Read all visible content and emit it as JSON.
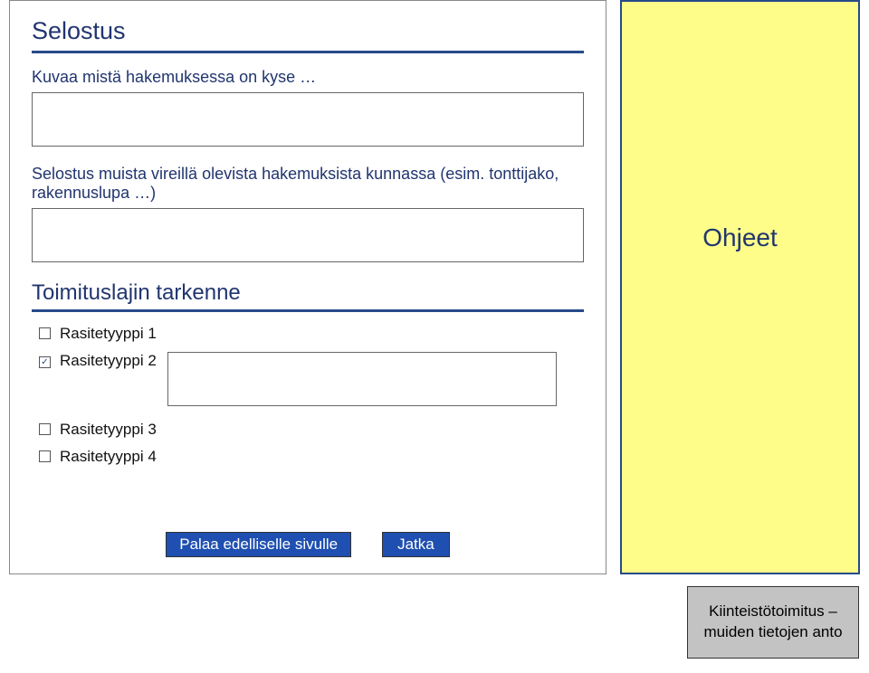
{
  "section": {
    "title": "Selostus",
    "field1_label": "Kuvaa mistä hakemuksessa on kyse …",
    "field2_label": "Selostus muista vireillä olevista hakemuksista kunnassa (esim. tonttijako, rakennuslupa …)"
  },
  "sub_section": {
    "title": "Toimituslajin tarkenne",
    "items": [
      {
        "label": "Rasitetyyppi 1",
        "checked": false,
        "has_detail": false
      },
      {
        "label": "Rasitetyyppi 2",
        "checked": true,
        "has_detail": true
      },
      {
        "label": "Rasitetyyppi 3",
        "checked": false,
        "has_detail": false
      },
      {
        "label": "Rasitetyyppi 4",
        "checked": false,
        "has_detail": false
      }
    ]
  },
  "buttons": {
    "back": "Palaa edelliselle sivulle",
    "next": "Jatka"
  },
  "panel": {
    "title": "Ohjeet"
  },
  "footer": {
    "text": "Kiinteistötoimitus – muiden tietojen anto"
  }
}
